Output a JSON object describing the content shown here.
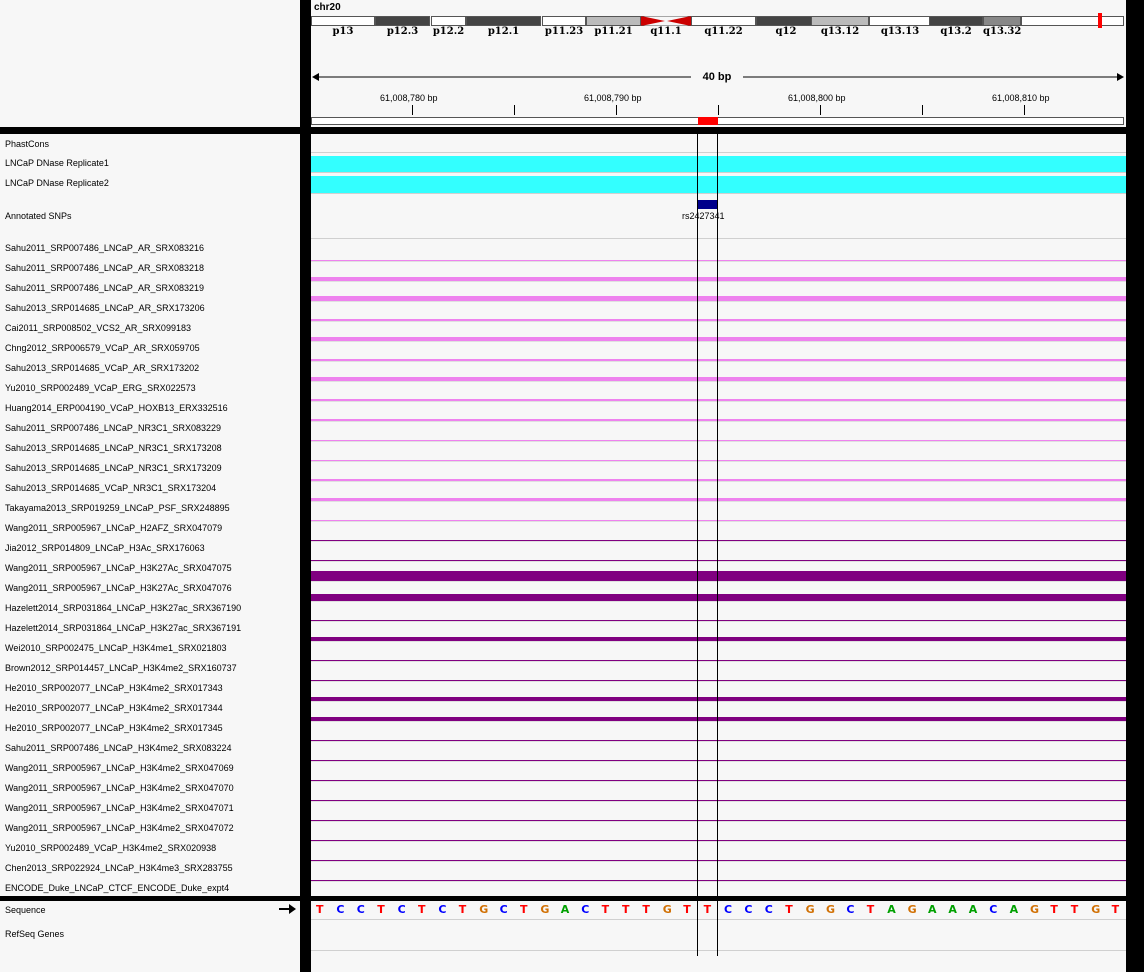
{
  "genome": {
    "chromosome": "chr20",
    "span_label": "40 bp",
    "bands": [
      {
        "name": "p13",
        "color": "#ffffff"
      },
      {
        "name": "p12.3",
        "color": "#444444"
      },
      {
        "name": "p12.2",
        "color": "#ffffff"
      },
      {
        "name": "p12.1",
        "color": "#444444"
      },
      {
        "name": "p11.23",
        "color": "#ffffff"
      },
      {
        "name": "p11.21",
        "color": "#bbbbbb"
      },
      {
        "name": "q11.1",
        "color": "#cc0000"
      },
      {
        "name": "q11.22",
        "color": "#ffffff"
      },
      {
        "name": "q12",
        "color": "#444444"
      },
      {
        "name": "q13.12",
        "color": "#bbbbbb"
      },
      {
        "name": "q13.13",
        "color": "#ffffff"
      },
      {
        "name": "q13.2",
        "color": "#444444"
      },
      {
        "name": "q13.32",
        "color": "#888888"
      }
    ],
    "ruler_ticks": [
      "61,008,780 bp",
      "61,008,790 bp",
      "61,008,800 bp",
      "61,008,810 bp"
    ]
  },
  "tracks": {
    "phastcons": "PhastCons",
    "dnase1": "LNCaP DNase Replicate1",
    "dnase2": "LNCaP DNase Replicate2",
    "snps": "Annotated SNPs",
    "snp_name": "rs2427341",
    "chip": [
      {
        "name": "Sahu2011_SRP007486_LNCaP_AR_SRX083216",
        "color": "#ee82ee"
      },
      {
        "name": "Sahu2011_SRP007486_LNCaP_AR_SRX083218",
        "color": "#ee82ee"
      },
      {
        "name": "Sahu2011_SRP007486_LNCaP_AR_SRX083219",
        "color": "#ee82ee"
      },
      {
        "name": "Sahu2013_SRP014685_LNCaP_AR_SRX173206",
        "color": "#ee82ee"
      },
      {
        "name": "Cai2011_SRP008502_VCS2_AR_SRX099183",
        "color": "#ee82ee"
      },
      {
        "name": "Chng2012_SRP006579_VCaP_AR_SRX059705",
        "color": "#ee82ee"
      },
      {
        "name": "Sahu2013_SRP014685_VCaP_AR_SRX173202",
        "color": "#ee82ee"
      },
      {
        "name": "Yu2010_SRP002489_VCaP_ERG_SRX022573",
        "color": "#ee82ee"
      },
      {
        "name": "Huang2014_ERP004190_VCaP_HOXB13_ERX332516",
        "color": "#ee82ee"
      },
      {
        "name": "Sahu2011_SRP007486_LNCaP_NR3C1_SRX083229",
        "color": "#ee82ee"
      },
      {
        "name": "Sahu2013_SRP014685_LNCaP_NR3C1_SRX173208",
        "color": "#ee82ee"
      },
      {
        "name": "Sahu2013_SRP014685_LNCaP_NR3C1_SRX173209",
        "color": "#ee82ee"
      },
      {
        "name": "Sahu2013_SRP014685_VCaP_NR3C1_SRX173204",
        "color": "#ee82ee"
      },
      {
        "name": "Takayama2013_SRP019259_LNCaP_PSF_SRX248895",
        "color": "#ee82ee"
      },
      {
        "name": "Wang2011_SRP005967_LNCaP_H2AFZ_SRX047079",
        "color": "#800080"
      },
      {
        "name": "Jia2012_SRP014809_LNCaP_H3Ac_SRX176063",
        "color": "#800080"
      },
      {
        "name": "Wang2011_SRP005967_LNCaP_H3K27Ac_SRX047075",
        "color": "#800080"
      },
      {
        "name": "Wang2011_SRP005967_LNCaP_H3K27Ac_SRX047076",
        "color": "#800080"
      },
      {
        "name": "Hazelett2014_SRP031864_LNCaP_H3K27ac_SRX367190",
        "color": "#800080"
      },
      {
        "name": "Hazelett2014_SRP031864_LNCaP_H3K27ac_SRX367191",
        "color": "#800080"
      },
      {
        "name": "Wei2010_SRP002475_LNCaP_H3K4me1_SRX021803",
        "color": "#800080"
      },
      {
        "name": "Brown2012_SRP014457_LNCaP_H3K4me2_SRX160737",
        "color": "#800080"
      },
      {
        "name": "He2010_SRP002077_LNCaP_H3K4me2_SRX017343",
        "color": "#800080"
      },
      {
        "name": "He2010_SRP002077_LNCaP_H3K4me2_SRX017344",
        "color": "#800080"
      },
      {
        "name": "He2010_SRP002077_LNCaP_H3K4me2_SRX017345",
        "color": "#800080"
      },
      {
        "name": "Sahu2011_SRP007486_LNCaP_H3K4me2_SRX083224",
        "color": "#800080"
      },
      {
        "name": "Wang2011_SRP005967_LNCaP_H3K4me2_SRX047069",
        "color": "#800080"
      },
      {
        "name": "Wang2011_SRP005967_LNCaP_H3K4me2_SRX047070",
        "color": "#800080"
      },
      {
        "name": "Wang2011_SRP005967_LNCaP_H3K4me2_SRX047071",
        "color": "#800080"
      },
      {
        "name": "Wang2011_SRP005967_LNCaP_H3K4me2_SRX047072",
        "color": "#800080"
      },
      {
        "name": "Yu2010_SRP002489_VCaP_H3K4me2_SRX020938",
        "color": "#800080"
      },
      {
        "name": "Chen2013_SRP022924_LNCaP_H3K4me3_SRX283755",
        "color": "#800080"
      },
      {
        "name": "ENCODE_Duke_LNCaP_CTCF_ENCODE_Duke_expt4",
        "color": "#800080"
      }
    ],
    "sequence_label": "Sequence",
    "refseq_label": "RefSeq Genes"
  },
  "sequence": "TCCTCTCTGCTGACTTTGTTCCCTGGCTAGAAACAGTTGT",
  "base_colors": {
    "A": "#00a000",
    "C": "#0000ff",
    "G": "#d17105",
    "T": "#ff0000"
  }
}
